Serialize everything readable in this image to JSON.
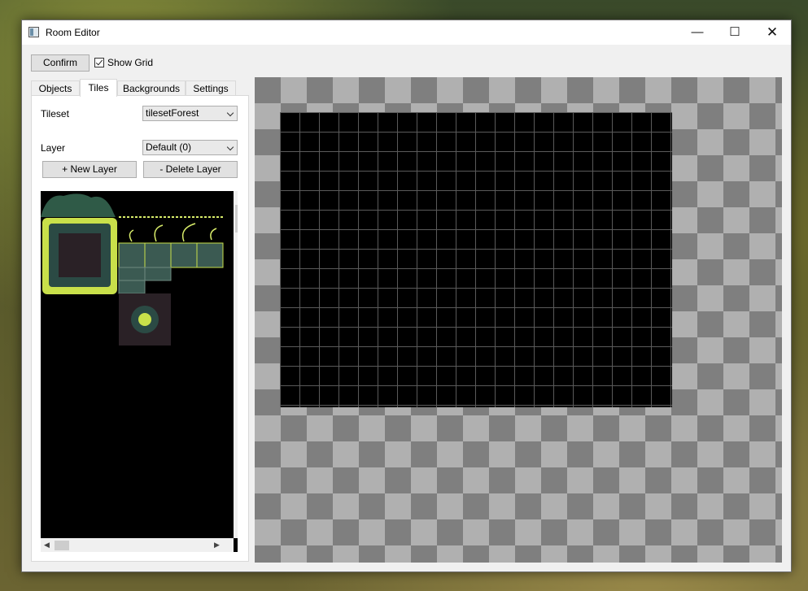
{
  "window": {
    "title": "Room Editor",
    "controls": {
      "minimize": "—",
      "maximize": "☐",
      "close": "✕"
    }
  },
  "toolbar": {
    "confirm_label": "Confirm",
    "show_grid_label": "Show Grid",
    "show_grid_checked": true
  },
  "tabs": [
    {
      "label": "Objects",
      "active": false
    },
    {
      "label": "Tiles",
      "active": true
    },
    {
      "label": "Backgrounds",
      "active": false
    },
    {
      "label": "Settings",
      "active": false
    }
  ],
  "tiles_panel": {
    "tileset_label": "Tileset",
    "tileset_value": "tilesetForest",
    "layer_label": "Layer",
    "layer_value": "Default (0)",
    "new_layer_label": "+ New Layer",
    "delete_layer_label": "- Delete Layer"
  },
  "colors": {
    "tile_green": "#3b5a52",
    "tile_accent": "#c9e04a",
    "canvas_light": "#b0b0b0",
    "canvas_dark": "#7f7f7f"
  }
}
